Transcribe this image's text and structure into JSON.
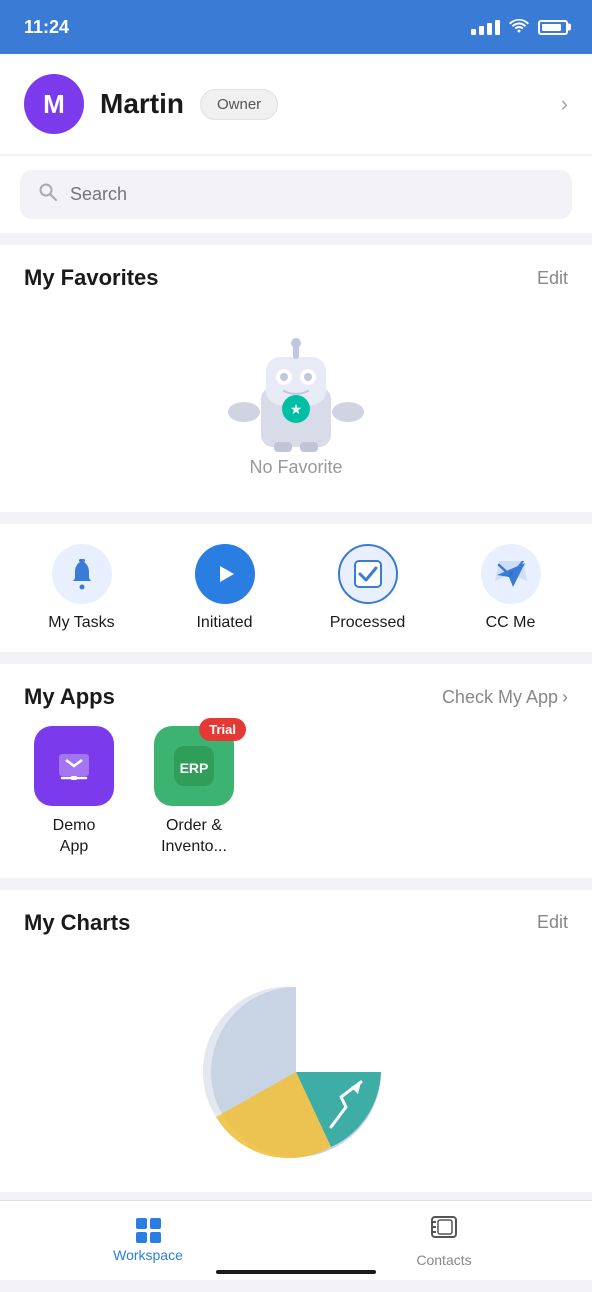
{
  "statusBar": {
    "time": "11:24"
  },
  "profile": {
    "initial": "M",
    "name": "Martin",
    "role": "Owner"
  },
  "search": {
    "placeholder": "Search"
  },
  "favorites": {
    "title": "My Favorites",
    "action": "Edit",
    "emptyText": "No Favorite"
  },
  "quickActions": [
    {
      "id": "tasks",
      "label": "My Tasks",
      "iconType": "bell"
    },
    {
      "id": "initiated",
      "label": "Initiated",
      "iconType": "play"
    },
    {
      "id": "processed",
      "label": "Processed",
      "iconType": "check"
    },
    {
      "id": "ccme",
      "label": "CC Me",
      "iconType": "mail"
    }
  ],
  "apps": {
    "title": "My Apps",
    "action": "Check My App",
    "items": [
      {
        "id": "demo",
        "label": "Demo\nApp",
        "labelLine1": "Demo",
        "labelLine2": "App",
        "iconType": "demo",
        "trial": false
      },
      {
        "id": "erp",
        "label": "Order & Invento...",
        "labelLine1": "Order &",
        "labelLine2": "Invento...",
        "iconType": "erp",
        "iconText": "ERP",
        "trial": true
      }
    ]
  },
  "charts": {
    "title": "My Charts",
    "action": "Edit"
  },
  "bottomNav": {
    "items": [
      {
        "id": "workspace",
        "label": "Workspace",
        "active": true
      },
      {
        "id": "contacts",
        "label": "Contacts",
        "active": false
      }
    ]
  }
}
